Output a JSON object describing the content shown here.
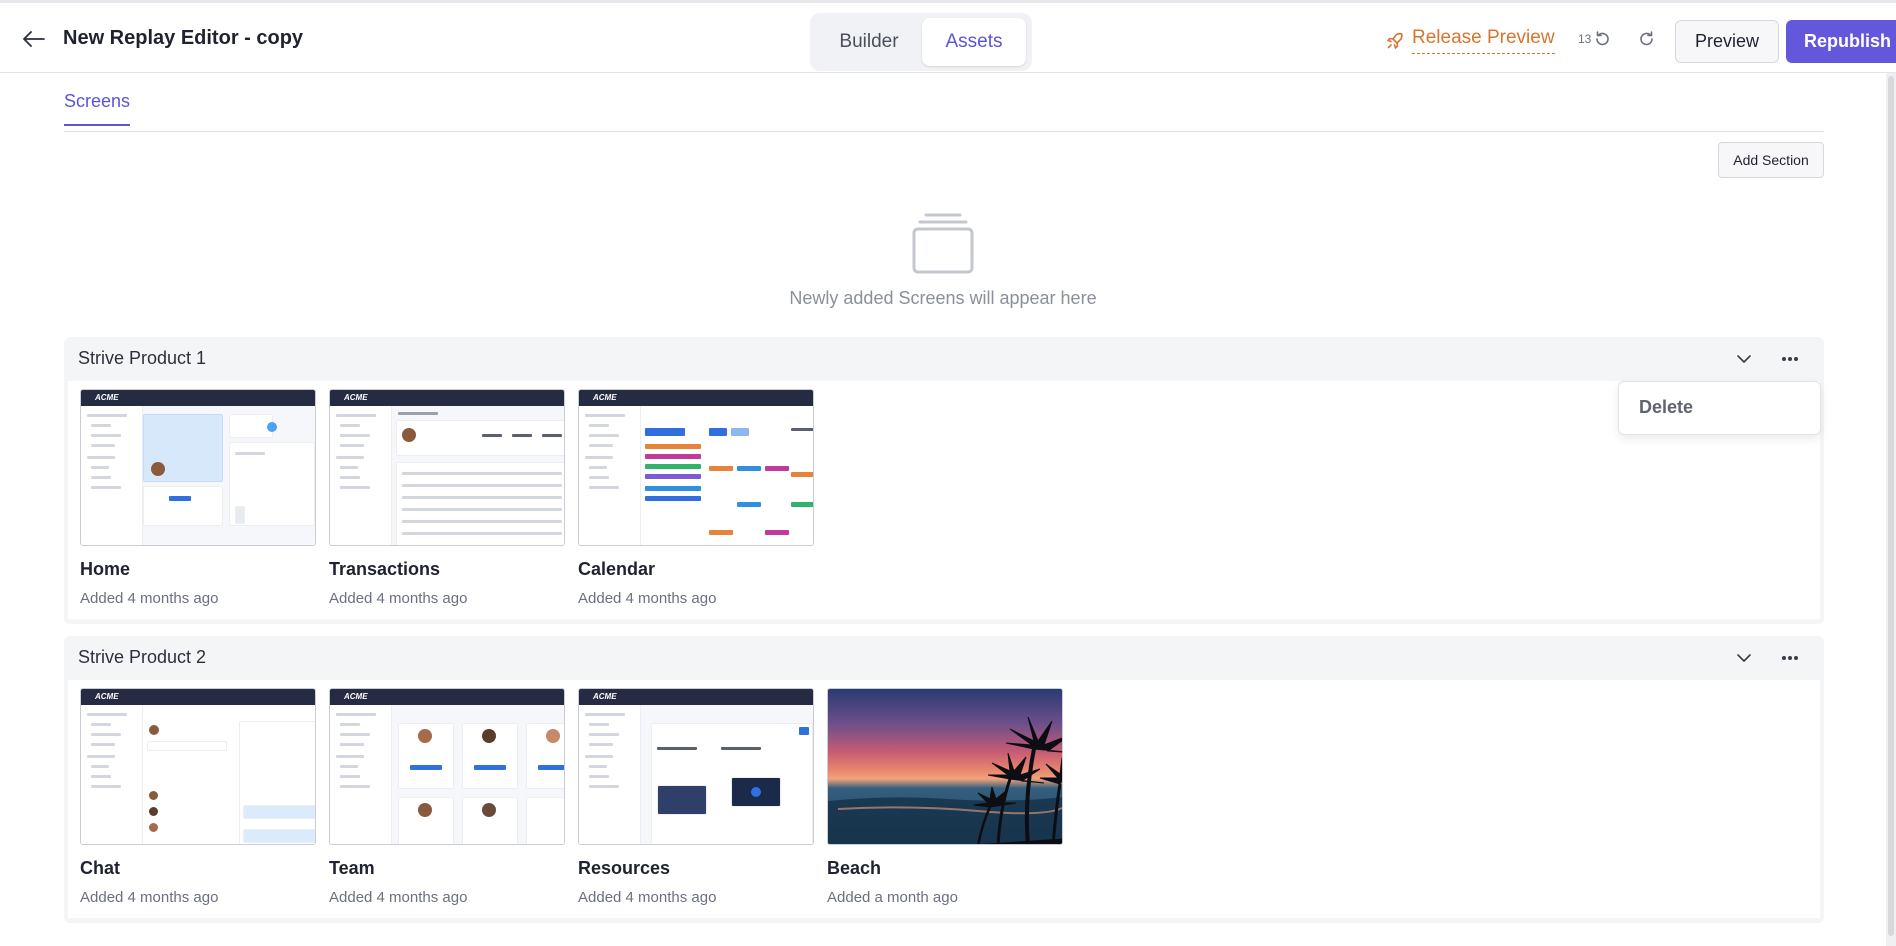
{
  "header": {
    "title": "New Replay Editor - copy",
    "modes": {
      "builder": "Builder",
      "assets": "Assets",
      "active": "Assets"
    },
    "release_preview": "Release Preview",
    "undo_count": "13",
    "preview_label": "Preview",
    "republish_label": "Republish"
  },
  "tabs": {
    "screens": "Screens"
  },
  "toolbar": {
    "add_section": "Add Section"
  },
  "empty_state": {
    "text": "Newly added Screens will appear here"
  },
  "sections": [
    {
      "title": "Strive Product 1",
      "screens": [
        {
          "name": "Home",
          "added": "Added 4 months ago"
        },
        {
          "name": "Transactions",
          "added": "Added 4 months ago"
        },
        {
          "name": "Calendar",
          "added": "Added 4 months ago"
        }
      ]
    },
    {
      "title": "Strive Product 2",
      "screens": [
        {
          "name": "Chat",
          "added": "Added 4 months ago"
        },
        {
          "name": "Team",
          "added": "Added 4 months ago"
        },
        {
          "name": "Resources",
          "added": "Added 4 months ago"
        },
        {
          "name": "Beach",
          "added": "Added a month ago"
        }
      ]
    }
  ],
  "menu": {
    "delete": "Delete"
  },
  "thumbnail_logo": "ACME",
  "colors": {
    "accent": "#5b55d6",
    "republish": "#6358dc",
    "release": "#d9742e"
  }
}
